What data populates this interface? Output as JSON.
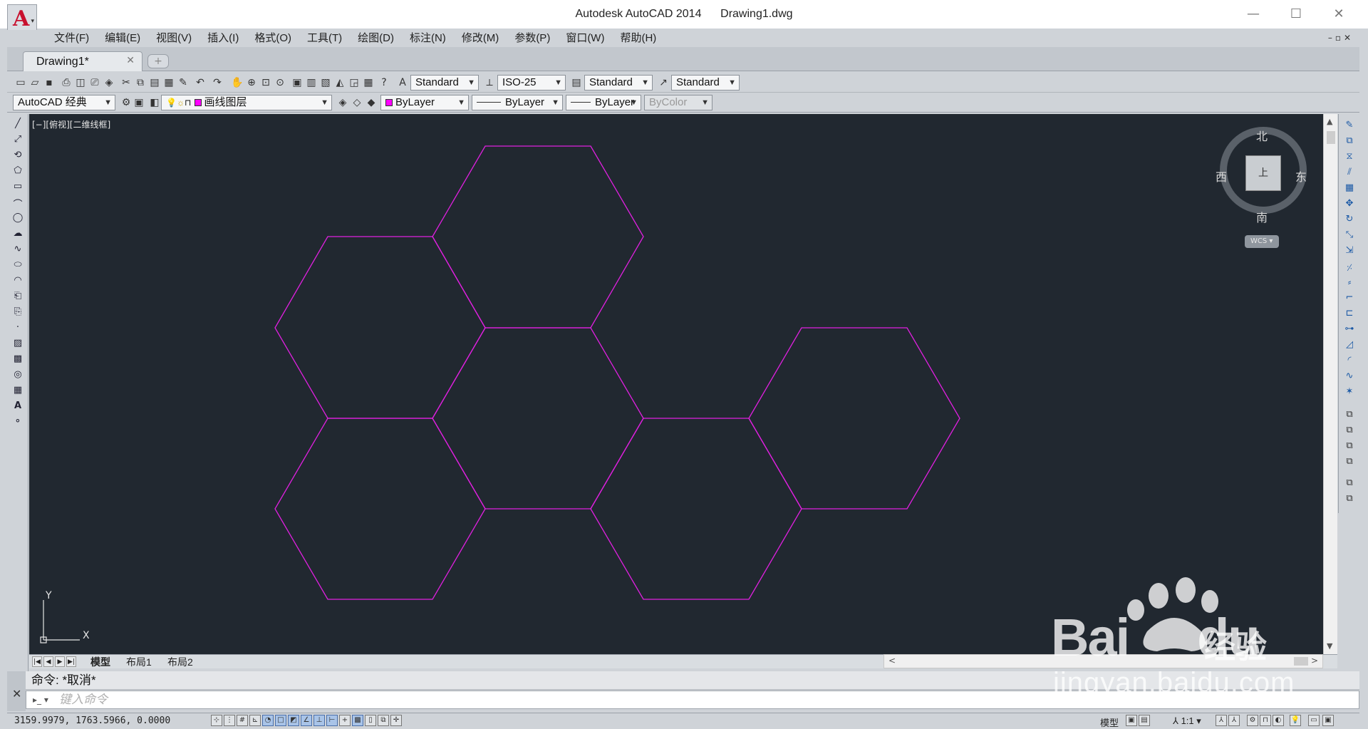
{
  "window": {
    "title": "Autodesk AutoCAD 2014      Drawing1.dwg",
    "minimize": "—",
    "maximize": "☐",
    "close": "✕"
  },
  "app_logo": {
    "letter": "A",
    "arrow": "▾"
  },
  "menu": {
    "items": [
      "文件(F)",
      "编辑(E)",
      "视图(V)",
      "插入(I)",
      "格式(O)",
      "工具(T)",
      "绘图(D)",
      "标注(N)",
      "修改(M)",
      "参数(P)",
      "窗口(W)",
      "帮助(H)"
    ],
    "mdi_buttons": "–▫✕"
  },
  "tabs": {
    "document": "Drawing1*",
    "close": "✕",
    "new": "+"
  },
  "toolbar1": {
    "text_style": "Standard",
    "dim_style": "ISO-25",
    "table_style": "Standard",
    "mleader_style": "Standard"
  },
  "toolbar2": {
    "workspace": "AutoCAD 经典",
    "layer": "画线图层",
    "color": "ByLayer",
    "linetype": "ByLayer",
    "lineweight": "ByLayer",
    "plotstyle": "ByColor"
  },
  "viewport": {
    "label": "[−][俯视][二维线框]",
    "line_color": "#e020e0",
    "background": "#212830"
  },
  "viewcube": {
    "north": "北",
    "south": "南",
    "west": "西",
    "east": "东",
    "face": "上",
    "wcs": "WCS ▾"
  },
  "ucs": {
    "y": "Y",
    "x": "X"
  },
  "layout_tabs": [
    "模型",
    "布局1",
    "布局2"
  ],
  "command": {
    "history": "命令: *取消*",
    "placeholder": "键入命令"
  },
  "status": {
    "coords": "3159.9979, 1763.5966, 0.0000",
    "model": "模型",
    "annotation_scale": "1:1"
  },
  "watermark": {
    "brand": "Bai",
    "brand2": "du",
    "product": "经验",
    "url": "jingyan.baidu.com"
  }
}
